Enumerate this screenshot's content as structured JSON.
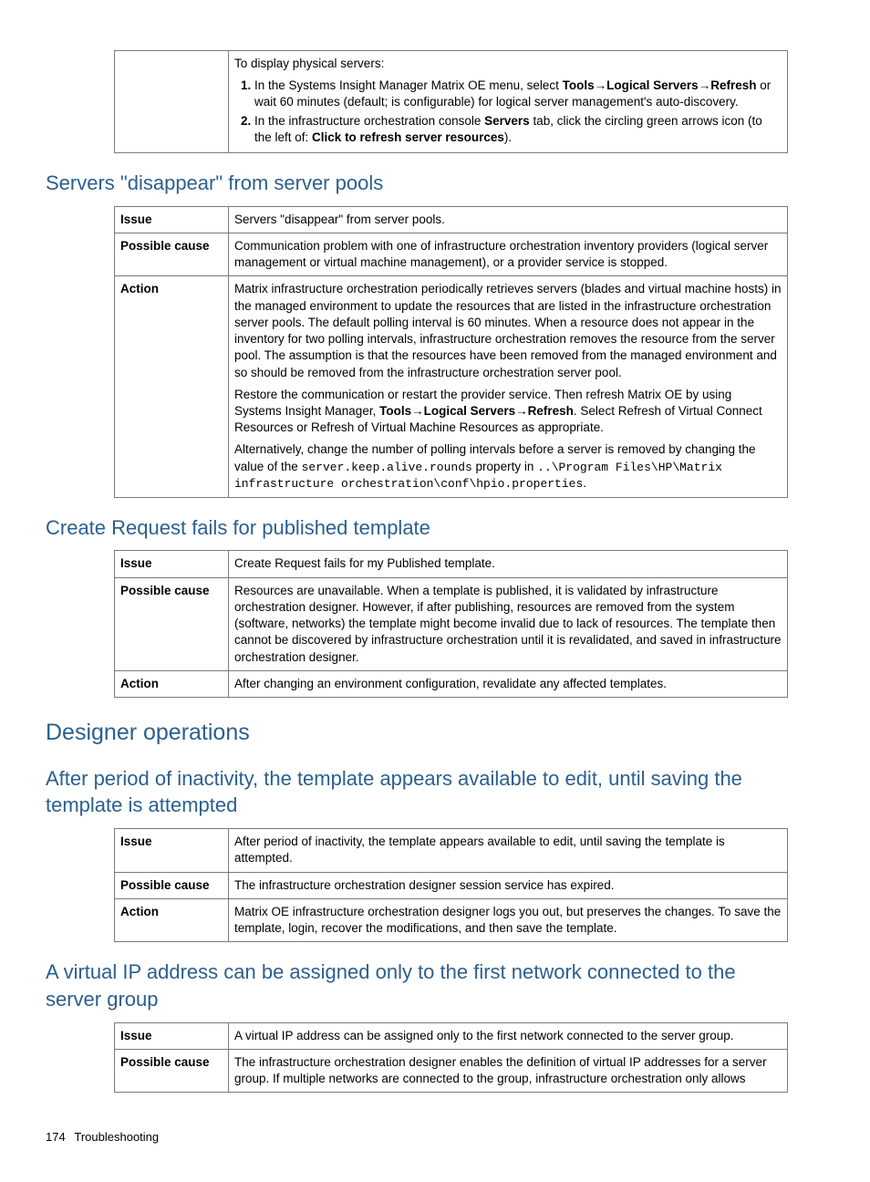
{
  "topbox": {
    "intro": "To display physical servers:",
    "step1_a": "In the Systems Insight Manager Matrix OE menu, select ",
    "step1_b1": "Tools",
    "step1_arrow": "→",
    "step1_b2": "Logical Servers",
    "step1_b3": "Refresh",
    "step1_c": " or wait 60 minutes (default; is configurable) for logical server management's auto-discovery.",
    "step2_a": "In the infrastructure orchestration console ",
    "step2_b": "Servers",
    "step2_c": " tab, click the circling green arrows icon (to the left of: ",
    "step2_d": "Click to refresh server resources",
    "step2_e": ")."
  },
  "labels": {
    "issue": "Issue",
    "cause": "Possible cause",
    "action": "Action"
  },
  "s1": {
    "heading": "Servers \"disappear\" from server pools",
    "issue": "Servers \"disappear\" from server pools.",
    "cause": "Communication problem with one of infrastructure orchestration inventory providers (logical server management or virtual machine management), or a provider service is stopped.",
    "action_p1": "Matrix infrastructure orchestration periodically retrieves servers (blades and virtual machine hosts) in the managed environment to update the resources that are listed in the infrastructure orchestration server pools. The default polling interval is 60 minutes. When a resource does not appear in the inventory for two polling intervals, infrastructure orchestration removes the resource from the server pool. The assumption is that the resources have been removed from the managed environment and so should be removed from the infrastructure orchestration server pool.",
    "action_p2_a": "Restore the communication or restart the provider service. Then refresh Matrix OE by using Systems Insight Manager, ",
    "action_p2_b1": "Tools",
    "action_p2_b2": "Logical Servers",
    "action_p2_b3": "Refresh",
    "action_p2_c": ". Select Refresh of Virtual Connect Resources or Refresh of Virtual Machine Resources as appropriate.",
    "action_p3_a": "Alternatively, change the number of polling intervals before a server is removed by changing the value of the ",
    "action_p3_code1": "server.keep.alive.rounds",
    "action_p3_b": " property in ",
    "action_p3_code2": "..\\Program Files\\HP\\Matrix infrastructure orchestration\\conf\\hpio.properties",
    "action_p3_c": "."
  },
  "s2": {
    "heading": "Create Request fails for published template",
    "issue": "Create Request fails for my Published template.",
    "cause": "Resources are unavailable. When a template is published, it is validated by infrastructure orchestration designer. However, if after publishing, resources are removed from the system (software, networks) the template might become invalid due to lack of resources. The template then cannot be discovered by infrastructure orchestration until it is revalidated, and saved in infrastructure orchestration designer.",
    "action": "After changing an environment configuration, revalidate any affected templates."
  },
  "big_heading": "Designer operations",
  "s3": {
    "heading": "After period of inactivity, the template appears available to edit, until saving the template is attempted",
    "issue": "After period of inactivity, the template appears available to edit, until saving the template is attempted.",
    "cause": "The infrastructure orchestration designer session service has expired.",
    "action": "Matrix OE infrastructure orchestration designer logs you out, but preserves the changes. To save the template, login, recover the modifications, and then save the template."
  },
  "s4": {
    "heading": "A virtual IP address can be assigned only to the first network connected to the server group",
    "issue": "A virtual IP address can be assigned only to the first network connected to the server group.",
    "cause": "The infrastructure orchestration designer enables the definition of virtual IP addresses for a server group. If multiple networks are connected to the group, infrastructure orchestration only allows"
  },
  "footer": {
    "page": "174",
    "title": "Troubleshooting"
  }
}
